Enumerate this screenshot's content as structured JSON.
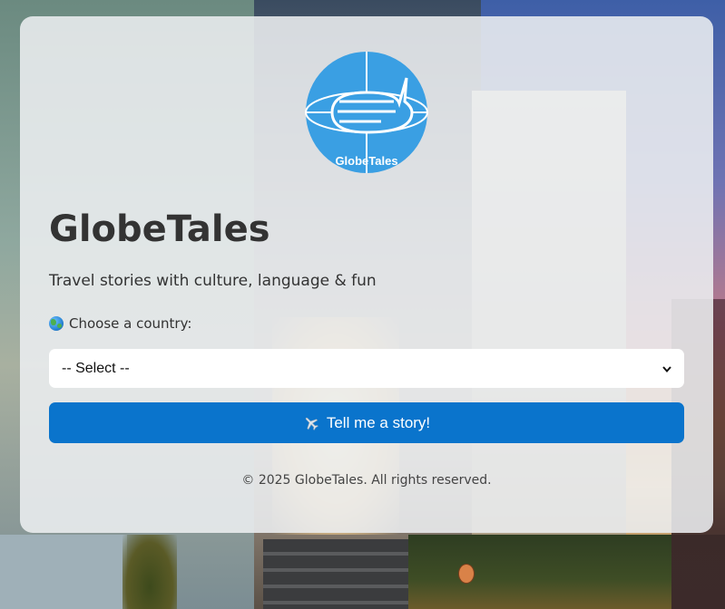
{
  "app": {
    "name": "GlobeTales",
    "logo_text": "GlobeTales",
    "tagline": "Travel stories with culture, language & fun"
  },
  "form": {
    "country_label": "Choose a country:",
    "country_icon": "globe-icon",
    "select_value": "-- Select --",
    "button_label": "Tell me a story!",
    "button_icon": "airplane-icon"
  },
  "footer": {
    "text": "© 2025 GlobeTales. All rights reserved."
  },
  "colors": {
    "accent": "#0a74cc",
    "logo_blue": "#3a9fe3",
    "card_bg": "#eceef0"
  }
}
